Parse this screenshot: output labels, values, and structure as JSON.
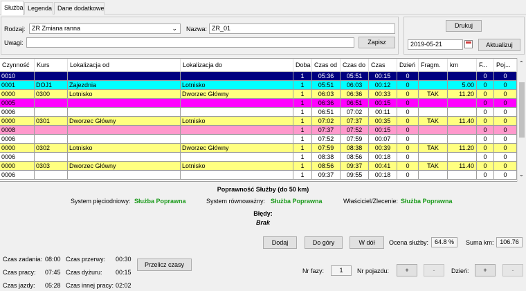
{
  "tabs": [
    "Służba",
    "Legenda",
    "Dane dodatkowe"
  ],
  "form": {
    "rodzaj_label": "Rodzaj:",
    "rodzaj_value": "ZR Zmiana ranna",
    "nazwa_label": "Nazwa:",
    "nazwa_value": "ZR_01",
    "uwagi_label": "Uwagi:",
    "uwagi_value": "",
    "zapisz": "Zapisz",
    "drukuj": "Drukuj",
    "date": "2019-05-21",
    "aktualizuj": "Aktualizuj"
  },
  "table": {
    "headers": [
      "Czynność",
      "Kurs",
      "Lokalizacja od",
      "Lokalizacja do",
      "Doba",
      "Czas od",
      "Czas do",
      "Czas",
      "Dzień",
      "Fragm.",
      "km",
      "F...",
      "Poj..."
    ],
    "rows": [
      {
        "color": "#000080",
        "text": "#ffffff",
        "cells": [
          "0010",
          "",
          "",
          "",
          "1",
          "05:36",
          "05:51",
          "00:15",
          "0",
          "",
          "",
          "0",
          "0"
        ]
      },
      {
        "color": "#00ffff",
        "text": "#000000",
        "cells": [
          "0001",
          "DOJ1",
          "Zajezdnia",
          "Lotnisko",
          "1",
          "05:51",
          "06:03",
          "00:12",
          "0",
          "",
          "5.00",
          "0",
          "0"
        ]
      },
      {
        "color": "#ffff80",
        "text": "#000000",
        "cells": [
          "0000",
          "0300",
          "Lotnisko",
          "Dworzec Główny",
          "1",
          "06:03",
          "06:36",
          "00:33",
          "0",
          "TAK",
          "11.20",
          "0",
          "0"
        ]
      },
      {
        "color": "#ff00ff",
        "text": "#000000",
        "cells": [
          "0005",
          "",
          "",
          "",
          "1",
          "06:36",
          "06:51",
          "00:15",
          "0",
          "",
          "",
          "0",
          "0"
        ]
      },
      {
        "color": "#ffffff",
        "text": "#000000",
        "cells": [
          "0006",
          "",
          "",
          "",
          "1",
          "06:51",
          "07:02",
          "00:11",
          "0",
          "",
          "",
          "0",
          "0"
        ]
      },
      {
        "color": "#ffff80",
        "text": "#000000",
        "cells": [
          "0000",
          "0301",
          "Dworzec Główny",
          "Lotnisko",
          "1",
          "07:02",
          "07:37",
          "00:35",
          "0",
          "TAK",
          "11.40",
          "0",
          "0"
        ]
      },
      {
        "color": "#ff99cc",
        "text": "#000000",
        "cells": [
          "0008",
          "",
          "",
          "",
          "1",
          "07:37",
          "07:52",
          "00:15",
          "0",
          "",
          "",
          "0",
          "0"
        ]
      },
      {
        "color": "#ffffff",
        "text": "#000000",
        "cells": [
          "0006",
          "",
          "",
          "",
          "1",
          "07:52",
          "07:59",
          "00:07",
          "0",
          "",
          "",
          "0",
          "0"
        ]
      },
      {
        "color": "#ffff80",
        "text": "#000000",
        "cells": [
          "0000",
          "0302",
          "Lotnisko",
          "Dworzec Główny",
          "1",
          "07:59",
          "08:38",
          "00:39",
          "0",
          "TAK",
          "11.20",
          "0",
          "0"
        ]
      },
      {
        "color": "#ffffff",
        "text": "#000000",
        "cells": [
          "0006",
          "",
          "",
          "",
          "1",
          "08:38",
          "08:56",
          "00:18",
          "0",
          "",
          "",
          "0",
          "0"
        ]
      },
      {
        "color": "#ffff80",
        "text": "#000000",
        "cells": [
          "0000",
          "0303",
          "Dworzec Główny",
          "Lotnisko",
          "1",
          "08:56",
          "09:37",
          "00:41",
          "0",
          "TAK",
          "11.40",
          "0",
          "0"
        ]
      },
      {
        "color": "#ffffff",
        "text": "#000000",
        "cells": [
          "0006",
          "",
          "",
          "",
          "1",
          "09:37",
          "09:55",
          "00:18",
          "0",
          "",
          "",
          "0",
          "0"
        ]
      }
    ]
  },
  "validity": {
    "title": "Poprawność Służby (do 50 km)",
    "sys5_label": "System pięciodniowy:",
    "sys5_value": "Służba Poprawna",
    "sysr_label": "System równoważny:",
    "sysr_value": "Służba Poprawna",
    "owner_label": "Właściciel/Zlecenie:",
    "owner_value": "Służba Poprawna",
    "errors_label": "Błędy:",
    "errors_value": "Brak"
  },
  "actions": {
    "dodaj": "Dodaj",
    "do_gory": "Do góry",
    "w_dol": "W dół",
    "ocena_label": "Ocena służby:",
    "ocena_value": "64.8 %",
    "suma_label": "Suma km:",
    "suma_value": "106.76"
  },
  "times": {
    "zadania_label": "Czas zadania:",
    "zadania_value": "08:00",
    "przerwy_label": "Czas przerwy:",
    "przerwy_value": "00:30",
    "pracy_label": "Czas pracy:",
    "pracy_value": "07:45",
    "dyzuru_label": "Czas dyżuru:",
    "dyzuru_value": "00:15",
    "jazdy_label": "Czas jazdy:",
    "jazdy_value": "05:28",
    "innej_label": "Czas innej pracy:",
    "innej_value": "02:02",
    "przelicz": "Przelicz czasy"
  },
  "bottom": {
    "faza_label": "Nr fazy:",
    "faza_value": "1",
    "pojazd_label": "Nr pojazdu:",
    "plus": "+",
    "minus": "-",
    "dzien_label": "Dzień:"
  }
}
